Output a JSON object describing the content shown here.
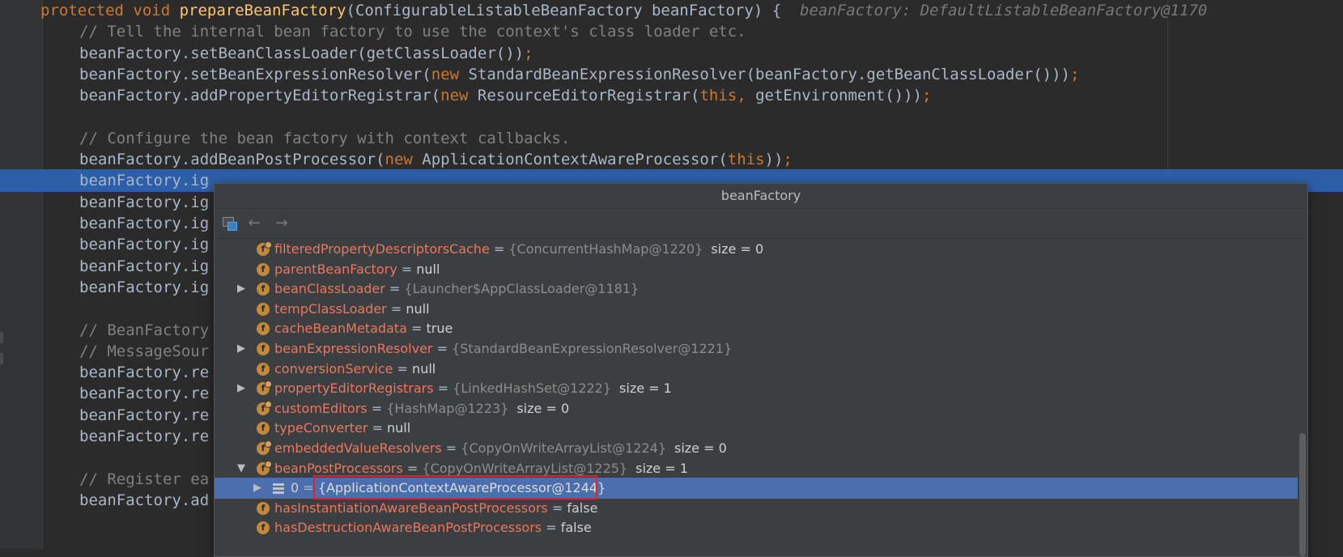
{
  "editor": {
    "lines": [
      {
        "segments": [
          {
            "t": "protected void ",
            "c": "kw"
          },
          {
            "t": "prepareBeanFactory",
            "c": "fn"
          },
          {
            "t": "(ConfigurableListableBeanFactory beanFactory) {  ",
            "c": ""
          },
          {
            "t": "beanFactory: DefaultListableBeanFactory@1170",
            "c": "hint"
          }
        ]
      },
      {
        "segments": [
          {
            "t": "// Tell the internal bean factory to use the context's class loader etc.",
            "c": "cm"
          }
        ]
      },
      {
        "segments": [
          {
            "t": "beanFactory.setBeanClassLoader(getClassLoader())",
            "c": ""
          },
          {
            "t": ";",
            "c": "kw"
          }
        ]
      },
      {
        "segments": [
          {
            "t": "beanFactory.setBeanExpressionResolver(",
            "c": ""
          },
          {
            "t": "new ",
            "c": "kw"
          },
          {
            "t": "StandardBeanExpressionResolver(beanFactory.getBeanClassLoader()))",
            "c": ""
          },
          {
            "t": ";",
            "c": "kw"
          }
        ]
      },
      {
        "segments": [
          {
            "t": "beanFactory.addPropertyEditorRegistrar(",
            "c": ""
          },
          {
            "t": "new ",
            "c": "kw"
          },
          {
            "t": "ResourceEditorRegistrar(",
            "c": ""
          },
          {
            "t": "this, ",
            "c": "kw"
          },
          {
            "t": "getEnvironment()))",
            "c": ""
          },
          {
            "t": ";",
            "c": "kw"
          }
        ]
      },
      {
        "segments": []
      },
      {
        "segments": [
          {
            "t": "// Configure the bean factory with context callbacks.",
            "c": "cm"
          }
        ]
      },
      {
        "segments": [
          {
            "t": "beanFactory.addBeanPostProcessor(",
            "c": ""
          },
          {
            "t": "new ",
            "c": "kw"
          },
          {
            "t": "ApplicationContextAwareProcessor(",
            "c": ""
          },
          {
            "t": "this",
            "c": "kw"
          },
          {
            "t": "))",
            "c": ""
          },
          {
            "t": ";",
            "c": "kw"
          }
        ]
      },
      {
        "segments": [
          {
            "t": "beanFactory.ig",
            "c": ""
          }
        ]
      },
      {
        "segments": [
          {
            "t": "beanFactory.ig",
            "c": ""
          }
        ]
      },
      {
        "segments": [
          {
            "t": "beanFactory.ig",
            "c": ""
          }
        ]
      },
      {
        "segments": [
          {
            "t": "beanFactory.ig",
            "c": ""
          }
        ]
      },
      {
        "segments": [
          {
            "t": "beanFactory.ig",
            "c": ""
          }
        ]
      },
      {
        "segments": [
          {
            "t": "beanFactory.ig",
            "c": ""
          }
        ]
      },
      {
        "segments": []
      },
      {
        "segments": [
          {
            "t": "// BeanFactory",
            "c": "cm"
          }
        ]
      },
      {
        "segments": [
          {
            "t": "// MessageSour",
            "c": "cm"
          }
        ]
      },
      {
        "segments": [
          {
            "t": "beanFactory.re",
            "c": ""
          }
        ]
      },
      {
        "segments": [
          {
            "t": "beanFactory.re",
            "c": ""
          }
        ]
      },
      {
        "segments": [
          {
            "t": "beanFactory.re",
            "c": ""
          }
        ]
      },
      {
        "segments": [
          {
            "t": "beanFactory.re",
            "c": ""
          }
        ]
      },
      {
        "segments": []
      },
      {
        "segments": [
          {
            "t": "// Register ea",
            "c": "cm"
          }
        ]
      },
      {
        "segments": [
          {
            "t": "beanFactory.ad",
            "c": ""
          }
        ]
      }
    ],
    "highlight_line": 8
  },
  "popup": {
    "title": "beanFactory",
    "back_arrow": "←",
    "forward_arrow": "→",
    "rows": [
      {
        "name": "filteredPropertyDescriptorsCache",
        "eq": " = ",
        "ref": "{ConcurrentHashMap@1220}",
        "val": "",
        "size": "size = 0",
        "expand": "",
        "lock": true
      },
      {
        "name": "parentBeanFactory",
        "eq": " = ",
        "ref": "",
        "val": "null",
        "size": "",
        "expand": "",
        "lock": false
      },
      {
        "name": "beanClassLoader",
        "eq": " = ",
        "ref": "{Launcher$AppClassLoader@1181}",
        "val": "",
        "size": "",
        "expand": "▶",
        "lock": false
      },
      {
        "name": "tempClassLoader",
        "eq": " = ",
        "ref": "",
        "val": "null",
        "size": "",
        "expand": "",
        "lock": false
      },
      {
        "name": "cacheBeanMetadata",
        "eq": " = ",
        "ref": "",
        "val": "true",
        "size": "",
        "expand": "",
        "lock": false
      },
      {
        "name": "beanExpressionResolver",
        "eq": " = ",
        "ref": "{StandardBeanExpressionResolver@1221}",
        "val": "",
        "size": "",
        "expand": "▶",
        "lock": false
      },
      {
        "name": "conversionService",
        "eq": " = ",
        "ref": "",
        "val": "null",
        "size": "",
        "expand": "",
        "lock": false
      },
      {
        "name": "propertyEditorRegistrars",
        "eq": " = ",
        "ref": "{LinkedHashSet@1222}",
        "val": "",
        "size": "size = 1",
        "expand": "▶",
        "lock": true
      },
      {
        "name": "customEditors",
        "eq": " = ",
        "ref": "{HashMap@1223}",
        "val": "",
        "size": "size = 0",
        "expand": "",
        "lock": true
      },
      {
        "name": "typeConverter",
        "eq": " = ",
        "ref": "",
        "val": "null",
        "size": "",
        "expand": "",
        "lock": false
      },
      {
        "name": "embeddedValueResolvers",
        "eq": " = ",
        "ref": "{CopyOnWriteArrayList@1224}",
        "val": "",
        "size": "size = 0",
        "expand": "",
        "lock": true
      },
      {
        "name": "beanPostProcessors",
        "eq": " = ",
        "ref": "{CopyOnWriteArrayList@1225}",
        "val": "",
        "size": "size = 1",
        "expand": "▼",
        "lock": true
      },
      {
        "name": "0",
        "eq": " = ",
        "ref": "{ApplicationContextAwareProcessor@1244}",
        "val": "",
        "size": "",
        "expand": "▶",
        "lock": false,
        "element": true,
        "selected": true
      },
      {
        "name": "hasInstantiationAwareBeanPostProcessors",
        "eq": " = ",
        "ref": "",
        "val": "false",
        "size": "",
        "expand": "",
        "lock": false
      },
      {
        "name": "hasDestructionAwareBeanPostProcessors",
        "eq": " = ",
        "ref": "",
        "val": "false",
        "size": "",
        "expand": "",
        "lock": false
      }
    ]
  }
}
